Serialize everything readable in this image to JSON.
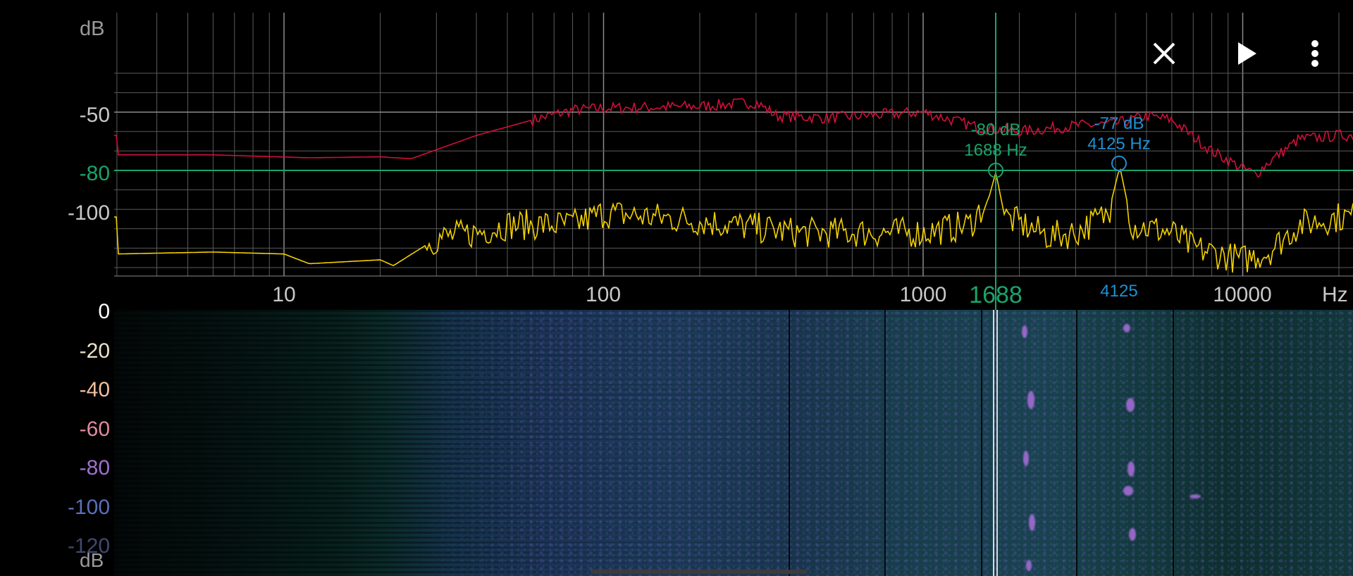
{
  "spectrum": {
    "y_unit": "dB",
    "x_unit": "Hz",
    "y_ticks": [
      "-50",
      "-80",
      "-100"
    ],
    "x_ticks": [
      "10",
      "100",
      "1000",
      "10000"
    ],
    "cursor": {
      "freq_label": "1688",
      "marker_db": "-80 dB",
      "marker_hz": "1688 Hz"
    },
    "peak": {
      "freq_label": "4125",
      "marker_db": "-77 dB",
      "marker_hz": "4125 Hz"
    },
    "colors": {
      "grid": "#5a5a5a",
      "peak_hold": "#d0103a",
      "live": "#f2d000",
      "cursor": "#1aa36a",
      "peak_marker": "#1e90d0",
      "axis_text": "#c8c8c8"
    }
  },
  "toolbar": {
    "close_icon": "close-icon",
    "play_icon": "play-icon",
    "menu_icon": "more-vert-icon"
  },
  "spectrogram": {
    "scale_labels": [
      "0",
      "-20",
      "-40",
      "-60",
      "-80",
      "-100",
      "-120"
    ],
    "scale_colors": [
      "#ffffff",
      "#e8e4c8",
      "#f0c0a0",
      "#e08aa0",
      "#a070d0",
      "#5a70b8",
      "#404a70"
    ],
    "unit": "dB"
  }
}
